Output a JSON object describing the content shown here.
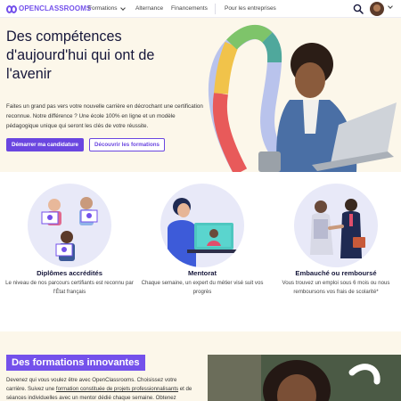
{
  "header": {
    "logo_text": "OPENCLASSROOMS",
    "nav": {
      "formations": "Formations",
      "alternance": "Alternance",
      "financements": "Financements",
      "entreprises": "Pour les entreprises"
    }
  },
  "hero": {
    "title": "Des compétences d'aujourd'hui qui ont de l'avenir",
    "text": "Faites un grand pas vers votre nouvelle carrière en décrochant une certification reconnue. Notre différence ? Une école 100% en ligne et un modèle pédagogique unique qui seront les clés de votre réussite.",
    "primary_button": "Démarrer ma candidature",
    "secondary_button": "Découvrir les formations"
  },
  "features": [
    {
      "title": "Diplômes accrédités",
      "text": "Le niveau de nos parcours certifiants est reconnu par l'État français"
    },
    {
      "title": "Mentorat",
      "text": "Chaque semaine, un expert du métier visé suit vos progrès"
    },
    {
      "title": "Embauché ou remboursé",
      "text": "Vous trouvez un emploi sous 6 mois ou nous remboursons vos frais de scolarité*"
    }
  ],
  "innovations": {
    "title": "Des formations innovantes",
    "text_before": "Devenez qui vous voulez être avec OpenClassrooms. Choisissez votre carrière. Suivez une ",
    "link": "formation constituée de projets professionnalisants",
    "text_after": " et de séances individuelles avec un mentor dédié chaque semaine. Obtenez"
  },
  "colors": {
    "brand": "#7451eb",
    "button": "#6a46e0",
    "hero_bg": "#fcf7ea",
    "feature_bg": "#e8e9f8"
  }
}
